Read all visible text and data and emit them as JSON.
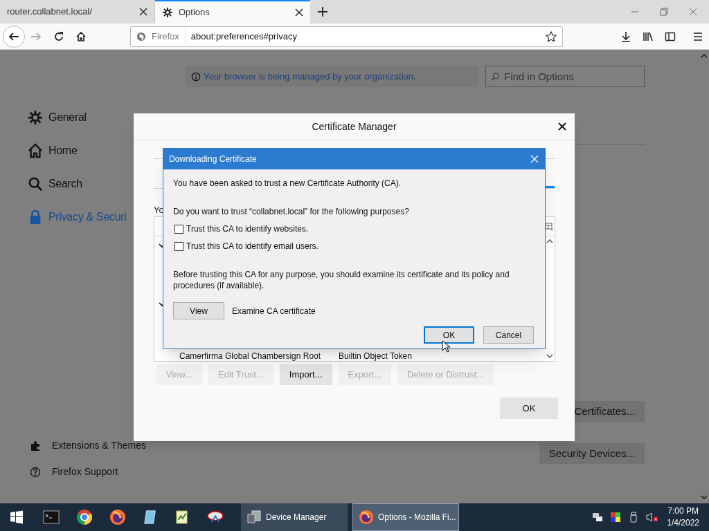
{
  "tabs": [
    {
      "label": "router.collabnet.local/",
      "selected": false
    },
    {
      "label": "Options",
      "selected": true
    }
  ],
  "address_bar": {
    "identity": "Firefox",
    "url": "about:preferences#privacy"
  },
  "page": {
    "notice": "Your browser is being managed by your organization.",
    "search": {
      "placeholder": "Find in Options"
    },
    "sidebar": [
      {
        "label": "General",
        "selected": false
      },
      {
        "label": "Home",
        "selected": false
      },
      {
        "label": "Search",
        "selected": false
      },
      {
        "label": "Privacy & Securi",
        "selected": true
      }
    ],
    "footer_links": [
      "Extensions & Themes",
      "Firefox Support"
    ],
    "buttons": [
      "Certificates...",
      "Security Devices..."
    ]
  },
  "certificate_manager": {
    "title": "Certificate Manager",
    "cut_text": "Yo",
    "row": {
      "name": "Camerfirma Global Chambersign Root",
      "token": "Builtin Object Token"
    },
    "buttons": [
      {
        "label": "View...",
        "disabled": true
      },
      {
        "label": "Edit Trust...",
        "disabled": true
      },
      {
        "label": "Import...",
        "disabled": false
      },
      {
        "label": "Export...",
        "disabled": true
      },
      {
        "label": "Delete or Distrust...",
        "disabled": true
      }
    ],
    "ok": "OK"
  },
  "download_dialog": {
    "title": "Downloading Certificate",
    "message": "You have been asked to trust a new Certificate Authority (CA).",
    "question": "Do you want to trust “collabnet.local” for the following purposes?",
    "options": [
      {
        "label": "Trust this CA to identify websites.",
        "checked": false
      },
      {
        "label": "Trust this CA to identify email users.",
        "checked": false
      }
    ],
    "note": "Before trusting this CA for any purpose, you should examine its certificate and its policy and procedures (if available).",
    "view_button": "View",
    "view_label": "Examine CA certificate",
    "buttons": [
      {
        "label": "OK",
        "default": true
      },
      {
        "label": "Cancel",
        "default": false
      }
    ]
  },
  "taskbar": {
    "windows": [
      {
        "label": "Device Manager",
        "selected": false
      },
      {
        "label": "Options - Mozilla Fi...",
        "selected": true
      }
    ],
    "time": "7:00 PM",
    "date": "1/4/2022"
  }
}
